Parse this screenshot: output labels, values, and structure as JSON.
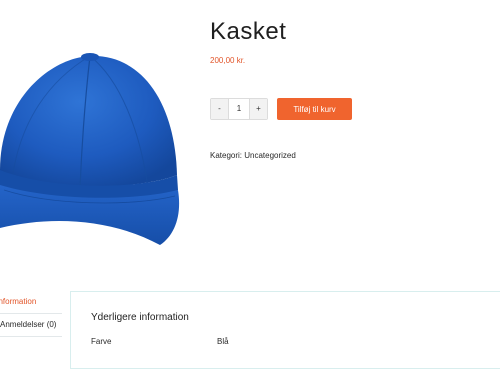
{
  "product": {
    "title": "Kasket",
    "price": "200,00 kr.",
    "image_icon": "blue-baseball-cap",
    "quantity": "1",
    "qty_minus": "-",
    "qty_plus": "+",
    "add_to_cart_label": "Tilføj til kurv",
    "category_text": "Kategori: Uncategorized"
  },
  "tabs": [
    {
      "label": "Yderligere information",
      "active": true
    },
    {
      "label": "Anmeldelser (0)",
      "active": false
    }
  ],
  "panel": {
    "heading": "Yderligere information",
    "attributes": [
      {
        "label": "Farve",
        "value": "Blå"
      }
    ]
  },
  "colors": {
    "accent": "#f0642e",
    "price": "#e2552a",
    "cap": "#1d5bc2"
  }
}
